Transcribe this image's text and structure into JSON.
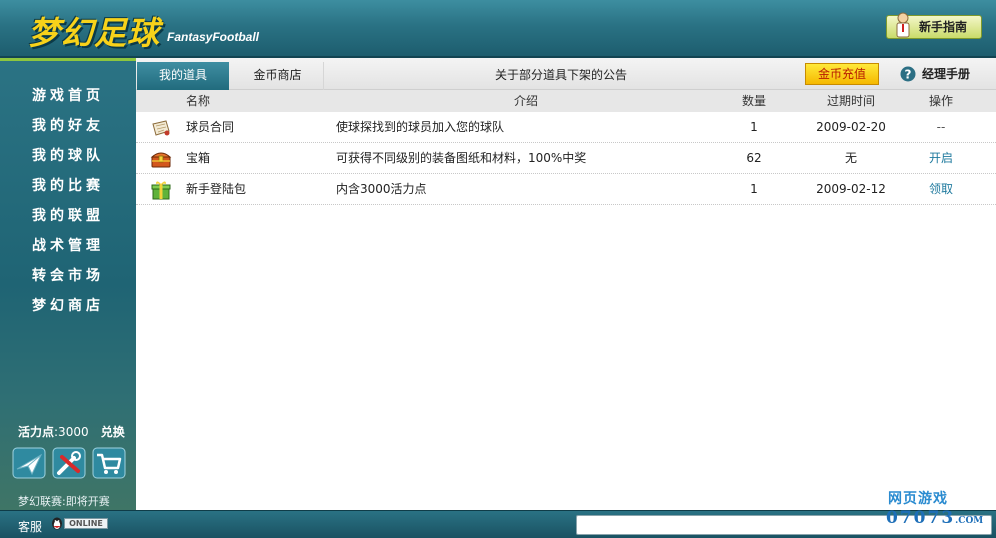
{
  "header": {
    "logo_cn": "梦幻足球",
    "logo_en": "FantasyFootball",
    "guide_label": "新手指南"
  },
  "sidebar": {
    "nav": [
      "游戏首页",
      "我的好友",
      "我的球队",
      "我的比赛",
      "我的联盟",
      "战术管理",
      "转会市场",
      "梦幻商店"
    ],
    "energy_label": "活力点",
    "energy_value": ":3000",
    "exchange_label": "兑换",
    "tool_icons": [
      "mail-icon",
      "settings-tools-icon",
      "cart-icon"
    ],
    "league_status": "梦幻联赛:即将开赛"
  },
  "main": {
    "tabs": [
      "我的道具",
      "金币商店"
    ],
    "notice": "关于部分道具下架的公告",
    "recharge_label": "金币充值",
    "manual_label": "经理手册",
    "columns": [
      "名称",
      "介绍",
      "数量",
      "过期时间",
      "操作"
    ],
    "rows": [
      {
        "icon": "contract-scroll-icon",
        "name": "球员合同",
        "desc": "使球探找到的球员加入您的球队",
        "qty": "1",
        "expires": "2009-02-20",
        "op": "--"
      },
      {
        "icon": "treasure-chest-icon",
        "name": "宝箱",
        "desc": "可获得不同级别的装备图纸和材料，100%中奖",
        "qty": "62",
        "expires": "无",
        "op": "开启"
      },
      {
        "icon": "gift-package-icon",
        "name": "新手登陆包",
        "desc": "内含3000活力点",
        "qty": "1",
        "expires": "2009-02-12",
        "op": "领取"
      }
    ]
  },
  "footer": {
    "service_label": "客服",
    "online_badge": "ONLINE"
  },
  "watermark": {
    "cn": "网页游戏",
    "num": "07073",
    "com": ".COM"
  },
  "colors": {
    "header_teal": "#2a7284",
    "logo_yellow": "#f7d21a",
    "accent_green": "#8dc63f",
    "recharge_yellow": "#f5b800",
    "link_blue": "#1f7a9e"
  }
}
